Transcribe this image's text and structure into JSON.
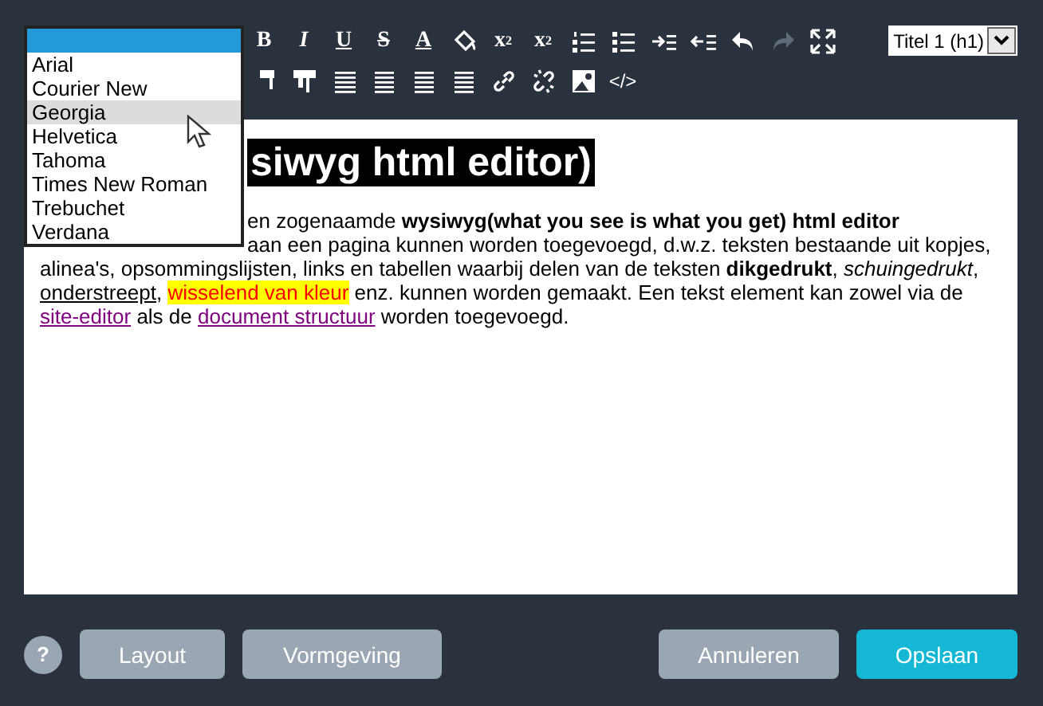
{
  "toolbar": {
    "row_1": [
      {
        "kind": "bold",
        "label": "B"
      },
      {
        "kind": "italic",
        "label": "I"
      },
      {
        "kind": "underline",
        "label": "U"
      },
      {
        "kind": "strike",
        "label": "S"
      },
      {
        "kind": "color",
        "label": "A"
      },
      {
        "kind": "fill"
      },
      {
        "kind": "sup",
        "label": "x",
        "sub": "2"
      },
      {
        "kind": "sub",
        "label": "x",
        "sub": "2"
      },
      {
        "kind": "ol"
      },
      {
        "kind": "ul"
      },
      {
        "kind": "indent"
      },
      {
        "kind": "outdent"
      },
      {
        "kind": "undo",
        "disabled": false
      },
      {
        "kind": "redo",
        "disabled": true
      },
      {
        "kind": "fullscreen"
      }
    ],
    "row_2": [
      {
        "kind": "table-a"
      },
      {
        "kind": "table-b"
      },
      {
        "kind": "align-left"
      },
      {
        "kind": "align-center"
      },
      {
        "kind": "align-right"
      },
      {
        "kind": "justify"
      },
      {
        "kind": "link"
      },
      {
        "kind": "unlink"
      },
      {
        "kind": "image"
      },
      {
        "kind": "code",
        "label": "</>"
      }
    ],
    "heading_select": {
      "value": "Titel 1 (h1)"
    }
  },
  "font_dropdown": {
    "blank_option_selected": true,
    "options": [
      {
        "label": "Arial",
        "hovered": false
      },
      {
        "label": "Courier New",
        "hovered": false
      },
      {
        "label": "Georgia",
        "hovered": true
      },
      {
        "label": "Helvetica",
        "hovered": false
      },
      {
        "label": "Tahoma",
        "hovered": false
      },
      {
        "label": "Times New Roman",
        "hovered": false
      },
      {
        "label": "Trebuchet",
        "hovered": false
      },
      {
        "label": "Verdana",
        "hovered": false
      }
    ]
  },
  "editor": {
    "heading": "siwyg html editor)",
    "lines": [
      {
        "indented": true,
        "runs": [
          {
            "kind": "plain",
            "text": "en zogenaamde "
          },
          {
            "kind": "bold",
            "text": "wysiwyg(what you see is what you get) html editor"
          }
        ]
      },
      {
        "indented": true,
        "runs": [
          {
            "kind": "plain",
            "text": "aan een pagina kunnen worden toegevoegd, d.w.z. teksten bestaande uit kopjes,"
          }
        ]
      },
      {
        "indented": false,
        "runs": [
          {
            "kind": "plain",
            "text": "alinea's, opsommingslijsten, links en tabellen waarbij delen van de teksten "
          },
          {
            "kind": "bold",
            "text": "dikgedrukt",
            "tail": ", "
          },
          {
            "kind": "italic",
            "text": "schuingedrukt",
            "tail": ","
          }
        ]
      },
      {
        "indented": false,
        "runs": [
          {
            "kind": "underline",
            "text": "onderstreept",
            "tail": ", "
          },
          {
            "kind": "highlight",
            "text": "wisselend van kleur"
          },
          {
            "kind": "plain",
            "text": " enz. kunnen worden gemaakt. Een tekst element kan zowel via de"
          }
        ]
      },
      {
        "indented": false,
        "runs": [
          {
            "kind": "link",
            "text": "site-editor"
          },
          {
            "kind": "plain",
            "text": " als de "
          },
          {
            "kind": "link",
            "text": "document structuur"
          },
          {
            "kind": "plain",
            "text": " worden toegevoegd."
          }
        ]
      }
    ]
  },
  "footer": {
    "help": "?",
    "left_buttons": [
      "Layout",
      "Vormgeving"
    ],
    "right_buttons": [
      {
        "label": "Annuleren",
        "kind": "secondary"
      },
      {
        "label": "Opslaan",
        "kind": "primary"
      }
    ]
  }
}
